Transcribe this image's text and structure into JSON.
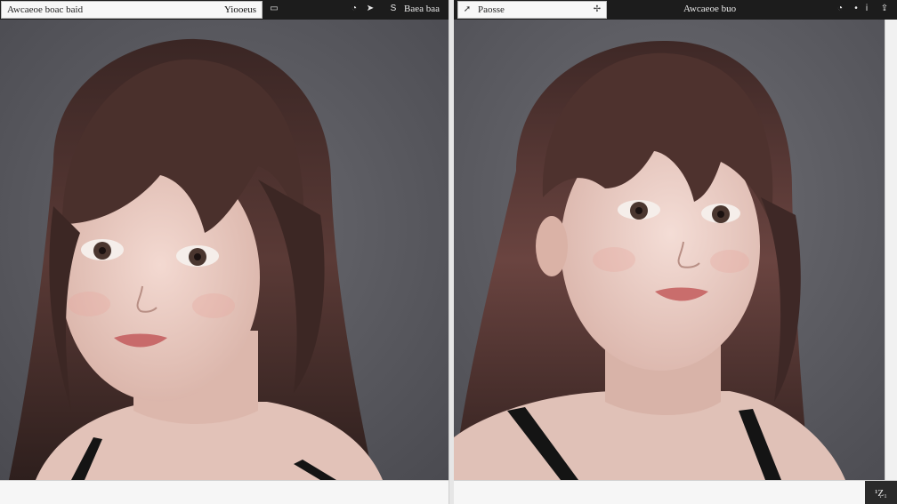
{
  "left_window": {
    "search_text": "Awcaeoe boac baid",
    "field_value": "Yiooeus",
    "toolbar_label": "Baea baa",
    "icons": [
      "image-icon",
      "clock-icon",
      "pin-icon",
      "s-icon"
    ]
  },
  "right_window": {
    "search_text": "Paosse",
    "title": "Awcaeoe buo",
    "corner_label": "¹Ẓ₁",
    "icons": [
      "cursor-icon",
      "pin-icon",
      "clock-icon",
      "dot-icon",
      "info-icon",
      "upload-icon"
    ]
  },
  "colors": {
    "toolbar": "#1c1c1c",
    "canvas_bg": "#5a5a5f",
    "hair": "#4a302c",
    "skin": "#e9cbc2"
  }
}
